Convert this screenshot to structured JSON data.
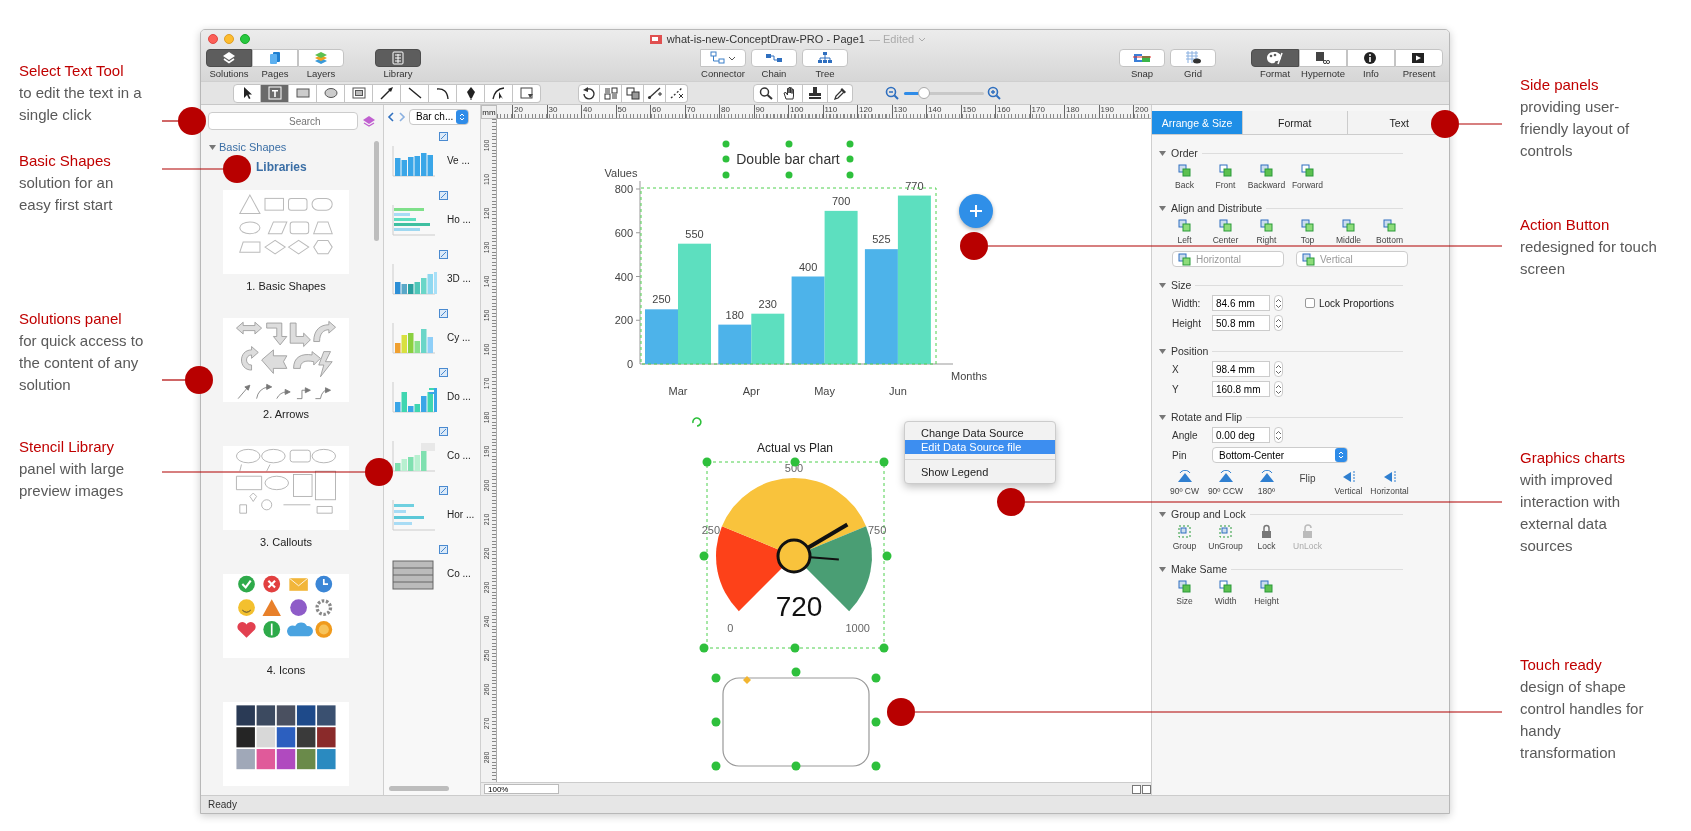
{
  "window": {
    "title": "what-is-new-ConceptDraw-PRO - Page1",
    "status": "— Edited"
  },
  "toolbar": {
    "panels": [
      {
        "label": "Solutions",
        "selected": true
      },
      {
        "label": "Pages",
        "selected": false
      },
      {
        "label": "Layers",
        "selected": false
      }
    ],
    "library": {
      "label": "Library",
      "selected": true
    },
    "connectors": [
      {
        "label": "Connector"
      },
      {
        "label": "Chain"
      },
      {
        "label": "Tree"
      }
    ],
    "snap": {
      "label": "Snap"
    },
    "grid": {
      "label": "Grid"
    },
    "inspectors": [
      {
        "label": "Format",
        "selected": true
      },
      {
        "label": "Hypernote",
        "selected": false
      },
      {
        "label": "Info",
        "selected": false
      },
      {
        "label": "Present",
        "selected": false
      }
    ]
  },
  "tools": [
    {
      "selected": false
    },
    {
      "selected": true
    },
    {
      "selected": false
    },
    {
      "selected": false
    },
    {
      "selected": false
    },
    {
      "selected": false
    },
    {
      "selected": false
    },
    {
      "selected": false
    },
    {
      "selected": false
    },
    {
      "selected": false
    },
    {
      "selected": false
    }
  ],
  "zoom_slider": {
    "level": 0.25
  },
  "solutions_panel": {
    "search": {
      "placeholder": "Search"
    },
    "tree": [
      {
        "label": "Basic Shapes",
        "expanded": true,
        "children": [
          {
            "label": "Libraries"
          }
        ]
      }
    ],
    "thumbnails": [
      {
        "kind": "shapes",
        "label": "1. Basic Shapes"
      },
      {
        "kind": "arrows",
        "label": "2. Arrows"
      },
      {
        "kind": "callouts",
        "label": "3. Callouts"
      },
      {
        "kind": "icons",
        "label": "4. Icons"
      },
      {
        "kind": "textures"
      }
    ]
  },
  "library_panel": {
    "dropdown": "Bar ch...",
    "items": [
      {
        "kind": "vbar",
        "label": "Ve ..."
      },
      {
        "kind": "hbar",
        "label": "Ho ..."
      },
      {
        "kind": "bar3d",
        "label": "3D ..."
      },
      {
        "kind": "cylinder",
        "label": "Cy ..."
      },
      {
        "kind": "double",
        "label": "Do ..."
      },
      {
        "kind": "combo",
        "label": "Co ..."
      },
      {
        "kind": "hbar2",
        "label": "Hor ..."
      },
      {
        "kind": "stack",
        "label": "Co ..."
      }
    ]
  },
  "rulers": {
    "unit": "mm",
    "horizontal": [
      "20",
      "30",
      "40",
      "50",
      "60",
      "70",
      "80",
      "90",
      "100",
      "110",
      "120",
      "130",
      "140",
      "150",
      "160",
      "170",
      "180",
      "190",
      "200"
    ],
    "vertical": [
      "100",
      "110",
      "120",
      "130",
      "140",
      "150",
      "160",
      "170",
      "180",
      "190",
      "200",
      "210",
      "220",
      "230",
      "240",
      "250",
      "260",
      "270",
      "280"
    ]
  },
  "canvas": {
    "bar_chart": {
      "chart_data": {
        "type": "bar",
        "title": "Double bar chart",
        "xlabel": "Months",
        "ylabel": "Values",
        "categories": [
          "Mar",
          "Apr",
          "May",
          "Jun"
        ],
        "series": [
          {
            "color": "#4db3ea",
            "values": [
              250,
              180,
              400,
              525
            ]
          },
          {
            "color": "#5ddfbf",
            "values": [
              550,
              230,
              700,
              770
            ]
          }
        ],
        "ylim": [
          0,
          800
        ],
        "yticks": [
          0,
          200,
          400,
          600,
          800
        ],
        "data_labels": true
      }
    },
    "gauge": {
      "title": "Actual vs Plan",
      "scale": [
        "0",
        "250",
        "500",
        "750",
        "1000"
      ],
      "reading": "720"
    },
    "context_menu": {
      "items": [
        {
          "kind": "item",
          "label": "Change Data Source",
          "selected": false
        },
        {
          "kind": "item",
          "label": "Edit Data Source file",
          "selected": true
        },
        {
          "kind": "separator"
        },
        {
          "kind": "item",
          "label": "Show Legend",
          "selected": false
        }
      ]
    },
    "zoom": "100%"
  },
  "inspector": {
    "tabs": [
      {
        "label": "Arrange & Size",
        "selected": true
      },
      {
        "label": "Format",
        "selected": false
      },
      {
        "label": "Text",
        "selected": false
      }
    ],
    "sections": [
      {
        "kind": "buttons",
        "title": "Order",
        "expanded": true,
        "buttons": [
          {
            "label": "Back"
          },
          {
            "label": "Front"
          },
          {
            "label": "Backward"
          },
          {
            "label": "Forward"
          }
        ]
      },
      {
        "kind": "align",
        "title": "Align and Distribute",
        "expanded": true,
        "buttons": [
          {
            "label": "Left"
          },
          {
            "label": "Center"
          },
          {
            "label": "Right"
          },
          {
            "label": "Top"
          },
          {
            "label": "Middle"
          },
          {
            "label": "Bottom"
          }
        ],
        "selects": [
          {
            "value": "Horizontal",
            "disabled": true
          },
          {
            "value": "Vertical",
            "disabled": true
          }
        ]
      },
      {
        "kind": "fields",
        "title": "Size",
        "expanded": true,
        "fields": [
          {
            "label": "Width:",
            "value": "84.6 mm"
          },
          {
            "label": "Height",
            "value": "50.8 mm"
          }
        ],
        "checkbox": {
          "label": "Lock Proportions",
          "checked": false
        }
      },
      {
        "kind": "fields",
        "title": "Position",
        "expanded": true,
        "fields": [
          {
            "label": "X",
            "value": "98.4 mm"
          },
          {
            "label": "Y",
            "value": "160.8 mm"
          }
        ]
      },
      {
        "kind": "rotate",
        "title": "Rotate and Flip",
        "expanded": true,
        "angle": {
          "label": "Angle",
          "value": "0.00 deg"
        },
        "pin": {
          "label": "Pin",
          "value": "Bottom-Center"
        },
        "buttons": [
          {
            "label": "90º CW"
          },
          {
            "label": "90º CCW"
          },
          {
            "label": "180º"
          }
        ],
        "flip_label": "Flip",
        "flip_buttons": [
          {
            "label": "Vertical"
          },
          {
            "label": "Horizontal"
          }
        ]
      },
      {
        "kind": "lock",
        "title": "Group and Lock",
        "expanded": true,
        "buttons": [
          {
            "label": "Group",
            "disabled": false
          },
          {
            "label": "UnGroup",
            "disabled": false
          },
          {
            "label": "Lock",
            "disabled": false
          },
          {
            "label": "UnLock",
            "disabled": true
          }
        ]
      },
      {
        "kind": "buttons",
        "title": "Make Same",
        "expanded": true,
        "buttons": [
          {
            "label": "Size"
          },
          {
            "label": "Width"
          },
          {
            "label": "Height"
          }
        ]
      }
    ]
  },
  "status_bar": {
    "text": "Ready"
  },
  "annotations": {
    "left": [
      {
        "title": "Select Text Tool",
        "text": "to edit the text in a single click"
      },
      {
        "title": "Basic Shapes",
        "text": "solution for an easy first start"
      },
      {
        "title": "Solutions panel",
        "text": "for quick access to the content of any solution"
      },
      {
        "title": "Stencil Library",
        "text": "panel  with large preview images"
      }
    ],
    "right": [
      {
        "title": "Side panels",
        "text": "providing  user-friendly layout of controls"
      },
      {
        "title": "Action Button",
        "text": "redesigned for touch screen"
      },
      {
        "title": "Graphics charts",
        "text": "with improved interaction with external data sources"
      },
      {
        "title": "Touch ready",
        "text": "design of shape control handles for handy transformation"
      }
    ]
  }
}
